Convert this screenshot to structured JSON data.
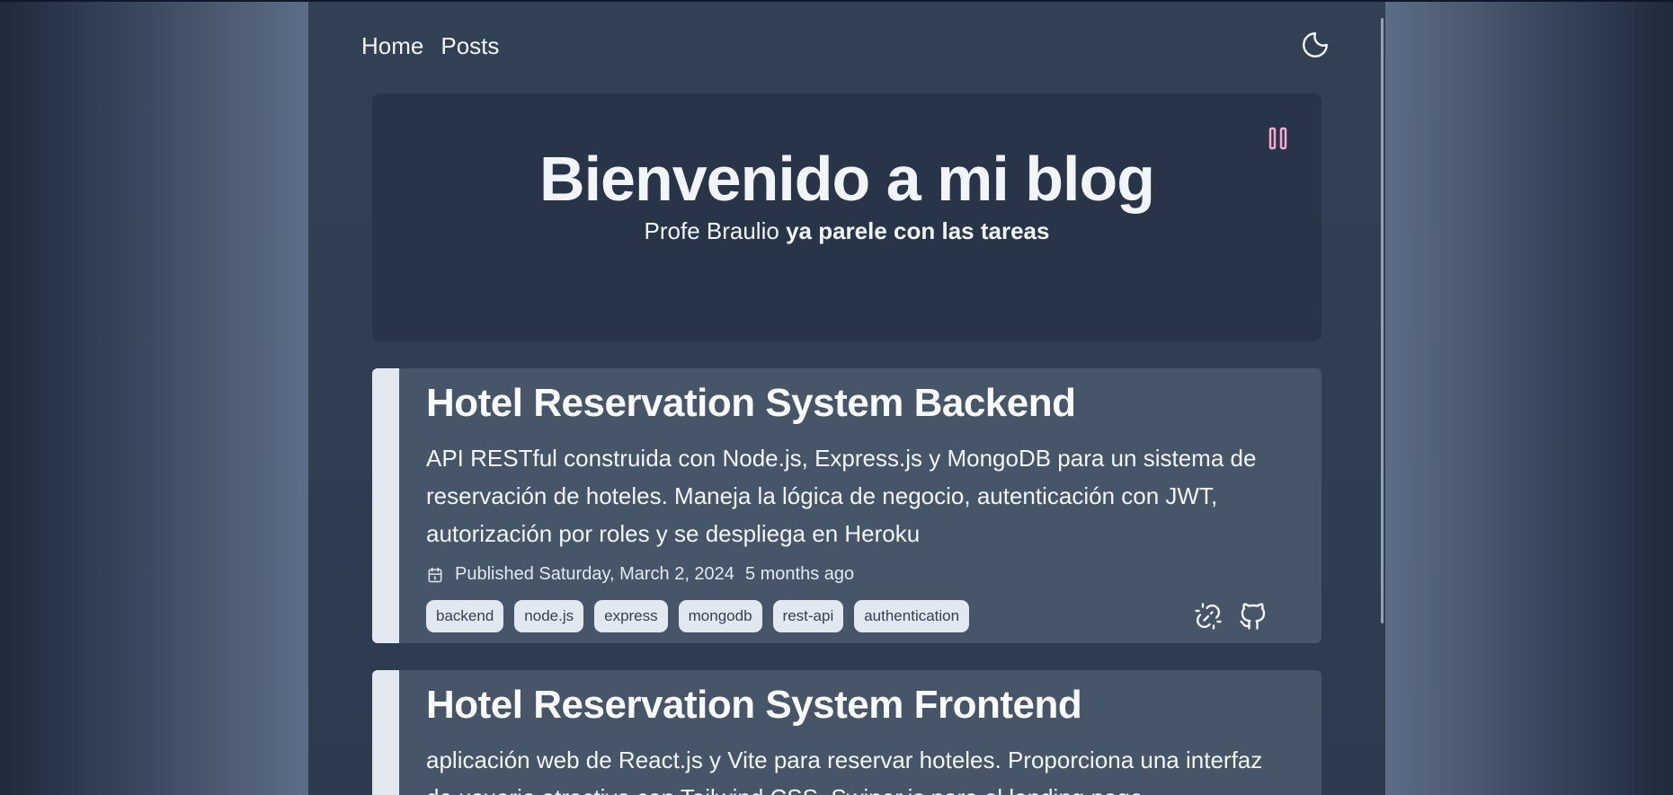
{
  "nav": {
    "items": [
      "Home",
      "Posts"
    ]
  },
  "icons": {
    "theme": "moon-icon",
    "pause": "pause-icon",
    "calendar": "calendar-icon",
    "link": "broken-link-icon",
    "github": "github-icon"
  },
  "colors": {
    "accent": "#f9a8d4",
    "page_bg": "#334155",
    "card_bg": "#475569",
    "hero_bg": "#283548",
    "tag_bg": "#e2e8f0",
    "text": "#f1f5f9"
  },
  "hero": {
    "title": "Bienvenido a mi blog",
    "subtitle_plain": "Profe Braulio",
    "subtitle_bold": "ya parele con las tareas"
  },
  "posts": [
    {
      "title": "Hotel Reservation System Backend",
      "description": "API RESTful construida con Node.js, Express.js y MongoDB para un sistema de reservación de hoteles. Maneja la lógica de negocio, autenticación con JWT, autorización por roles y se despliega en Heroku",
      "published": "Published Saturday, March 2, 2024",
      "relative": "5 months ago",
      "tags": [
        "backend",
        "node.js",
        "express",
        "mongodb",
        "rest-api",
        "authentication"
      ]
    },
    {
      "title": "Hotel Reservation System Frontend",
      "description": "aplicación web de React.js y Vite para reservar hoteles. Proporciona una interfaz de usuario atractiva con Tailwind CSS, Swiper.js para el landing page"
    }
  ]
}
